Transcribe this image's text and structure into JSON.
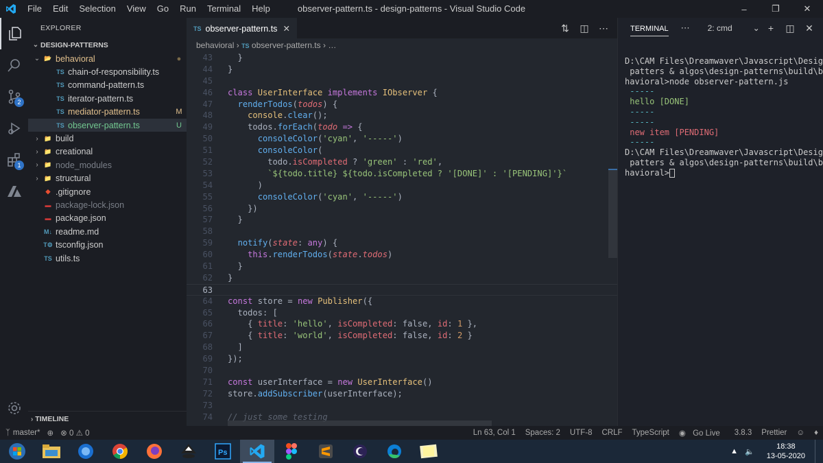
{
  "titlebar": {
    "menu": [
      "File",
      "Edit",
      "Selection",
      "View",
      "Go",
      "Run",
      "Terminal",
      "Help"
    ],
    "title": "observer-pattern.ts - design-patterns - Visual Studio Code"
  },
  "activity": {
    "source_control_badge": "2",
    "extensions_badge": "1"
  },
  "explorer": {
    "title": "EXPLORER",
    "root": "DESIGN-PATTERNS",
    "items": [
      {
        "name": "behavioral",
        "kind": "folder-open",
        "status": "●",
        "depth": 0
      },
      {
        "name": "chain-of-responsibility.ts",
        "kind": "ts",
        "status": "",
        "depth": 1
      },
      {
        "name": "command-pattern.ts",
        "kind": "ts",
        "status": "",
        "depth": 1
      },
      {
        "name": "iterator-pattern.ts",
        "kind": "ts",
        "status": "",
        "depth": 1
      },
      {
        "name": "mediator-pattern.ts",
        "kind": "ts",
        "status": "M",
        "depth": 1
      },
      {
        "name": "observer-pattern.ts",
        "kind": "ts",
        "status": "U",
        "depth": 1
      },
      {
        "name": "build",
        "kind": "folder",
        "status": "",
        "depth": 0
      },
      {
        "name": "creational",
        "kind": "folder",
        "status": "",
        "depth": 0
      },
      {
        "name": "node_modules",
        "kind": "folder",
        "status": "",
        "depth": 0
      },
      {
        "name": "structural",
        "kind": "folder",
        "status": "",
        "depth": 0
      },
      {
        "name": ".gitignore",
        "kind": "git",
        "status": "",
        "depth": 0
      },
      {
        "name": "package-lock.json",
        "kind": "npm",
        "status": "",
        "depth": 0
      },
      {
        "name": "package.json",
        "kind": "npm",
        "status": "",
        "depth": 0
      },
      {
        "name": "readme.md",
        "kind": "md",
        "status": "",
        "depth": 0
      },
      {
        "name": "tsconfig.json",
        "kind": "tsconfig",
        "status": "",
        "depth": 0
      },
      {
        "name": "utils.ts",
        "kind": "ts",
        "status": "",
        "depth": 0
      }
    ],
    "timeline": "TIMELINE"
  },
  "editor": {
    "tab": "observer-pattern.ts",
    "tab_prefix": "TS",
    "breadcrumb": {
      "folder": "behavioral",
      "file": "observer-pattern.ts",
      "more": "…"
    },
    "current_line": 63,
    "lines": [
      {
        "n": 43,
        "t": "    }"
      },
      {
        "n": 44,
        "t": "  }"
      },
      {
        "n": 45,
        "t": ""
      },
      {
        "n": 46,
        "t": "  class UserInterface implements IObserver {"
      },
      {
        "n": 47,
        "t": "    renderTodos(todos) {"
      },
      {
        "n": 48,
        "t": "      console.clear();"
      },
      {
        "n": 49,
        "t": "      todos.forEach(todo => {"
      },
      {
        "n": 50,
        "t": "        consoleColor('cyan', '-----')"
      },
      {
        "n": 51,
        "t": "        consoleColor("
      },
      {
        "n": 52,
        "t": "          todo.isCompleted ? 'green' : 'red',"
      },
      {
        "n": 53,
        "t": "          `${todo.title} ${todo.isCompleted ? '[DONE]' : '[PENDING]'}`"
      },
      {
        "n": 54,
        "t": "        )"
      },
      {
        "n": 55,
        "t": "        consoleColor('cyan', '-----')"
      },
      {
        "n": 56,
        "t": "      })"
      },
      {
        "n": 57,
        "t": "    }"
      },
      {
        "n": 58,
        "t": ""
      },
      {
        "n": 59,
        "t": "    notify(state: any) {"
      },
      {
        "n": 60,
        "t": "      this.renderTodos(state.todos)"
      },
      {
        "n": 61,
        "t": "    }"
      },
      {
        "n": 62,
        "t": "  }"
      },
      {
        "n": 63,
        "t": ""
      },
      {
        "n": 64,
        "t": "  const store = new Publisher({"
      },
      {
        "n": 65,
        "t": "    todos: ["
      },
      {
        "n": 66,
        "t": "      { title: 'hello', isCompleted: false, id: 1 },"
      },
      {
        "n": 67,
        "t": "      { title: 'world', isCompleted: false, id: 2 }"
      },
      {
        "n": 68,
        "t": "    ]"
      },
      {
        "n": 69,
        "t": "  });"
      },
      {
        "n": 70,
        "t": ""
      },
      {
        "n": 71,
        "t": "  const userInterface = new UserInterface()"
      },
      {
        "n": 72,
        "t": "  store.addSubscriber(userInterface);"
      },
      {
        "n": 73,
        "t": ""
      },
      {
        "n": 74,
        "t": "  // just some testing"
      }
    ]
  },
  "terminal": {
    "label": "TERMINAL",
    "selector": "2: cmd",
    "lines": [
      {
        "text": "D:\\CAM Files\\Dreamwaver\\Javascript\\Design",
        "c": ""
      },
      {
        "text": " patters & algos\\design-patterns\\build\\be",
        "c": ""
      },
      {
        "text": "havioral>node observer-pattern.js",
        "c": ""
      },
      {
        "text": " -----",
        "c": "tcyan"
      },
      {
        "text": " hello [DONE]",
        "c": "tgreen"
      },
      {
        "text": " -----",
        "c": "tcyan"
      },
      {
        "text": " -----",
        "c": "tcyan"
      },
      {
        "text": " new item [PENDING]",
        "c": "tred"
      },
      {
        "text": " -----",
        "c": "tcyan"
      },
      {
        "text": "",
        "c": ""
      },
      {
        "text": "D:\\CAM Files\\Dreamwaver\\Javascript\\Design",
        "c": ""
      },
      {
        "text": " patters & algos\\design-patterns\\build\\be",
        "c": ""
      },
      {
        "text": "havioral>",
        "c": ""
      }
    ]
  },
  "statusbar": {
    "branch": "master*",
    "problems": "⊗ 0 ⚠ 0",
    "position": "Ln 63, Col 1",
    "spaces": "Spaces: 2",
    "encoding": "UTF-8",
    "eol": "CRLF",
    "language": "TypeScript",
    "golive": "Go Live",
    "version": "3.8.3",
    "prettier": "Prettier"
  },
  "taskbar": {
    "time": "18:38",
    "date": "13-05-2020",
    "apps": [
      "start",
      "file-explorer",
      "firefox-dev",
      "chrome",
      "firefox",
      "inkscape",
      "photoshop",
      "vscode",
      "figma",
      "sublime",
      "eclipse",
      "edge",
      "notes"
    ]
  },
  "colors": {
    "accent": "#2f73c7",
    "modified": "#e2c08d",
    "untracked": "#73c991",
    "ts": "#519aba"
  }
}
